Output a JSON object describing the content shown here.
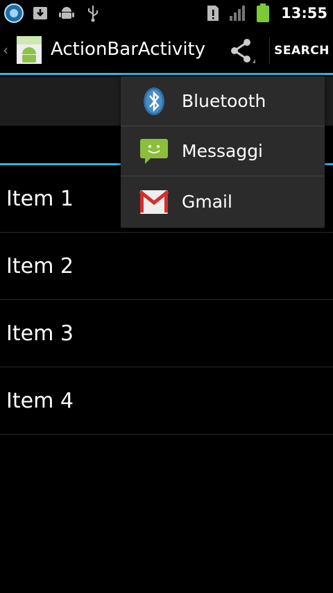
{
  "status_bar": {
    "time": "13:55",
    "icons_left": [
      "app-notification-icon",
      "download-icon",
      "android-debug-icon",
      "usb-icon"
    ],
    "icons_right": [
      "sim-alert-icon",
      "signal-icon",
      "battery-icon"
    ]
  },
  "action_bar": {
    "title": "ActionBarActivity",
    "search_label": "SEARCH",
    "share_icon": "share-icon"
  },
  "share_popup": {
    "items": [
      {
        "label": "Bluetooth",
        "icon": "bluetooth-icon"
      },
      {
        "label": "Messaggi",
        "icon": "messaging-icon"
      },
      {
        "label": "Gmail",
        "icon": "gmail-icon"
      }
    ]
  },
  "list": {
    "items": [
      {
        "label": "Item 1"
      },
      {
        "label": "Item 2"
      },
      {
        "label": "Item 3"
      },
      {
        "label": "Item 4"
      }
    ]
  },
  "colors": {
    "accent": "#33b5e5",
    "background": "#000000",
    "popup_bg": "#2b2b2b",
    "battery": "#7cc93a"
  }
}
